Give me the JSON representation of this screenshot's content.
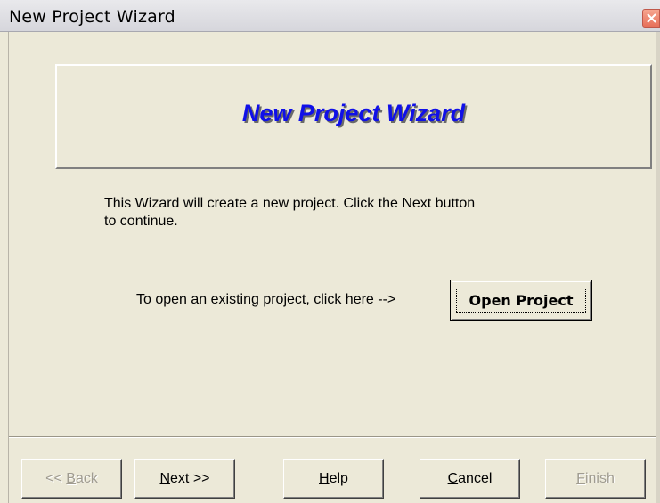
{
  "window": {
    "title": "New Project Wizard"
  },
  "banner": {
    "title": "New Project Wizard",
    "title_color": "#1010e8"
  },
  "intro": {
    "text": "This Wizard will create a new  project.   Click the Next button to continue."
  },
  "open_project": {
    "prompt": "To open an existing project, click here -->",
    "button_label": "Open Project"
  },
  "buttons": [
    {
      "label": "<< Back",
      "enabled": false
    },
    {
      "label": "Next >>",
      "enabled": true
    },
    {
      "label": "Help",
      "enabled": true
    },
    {
      "label": "Cancel",
      "enabled": true
    },
    {
      "label": "Finish",
      "enabled": false
    }
  ],
  "icons": {
    "close": "close-icon"
  }
}
